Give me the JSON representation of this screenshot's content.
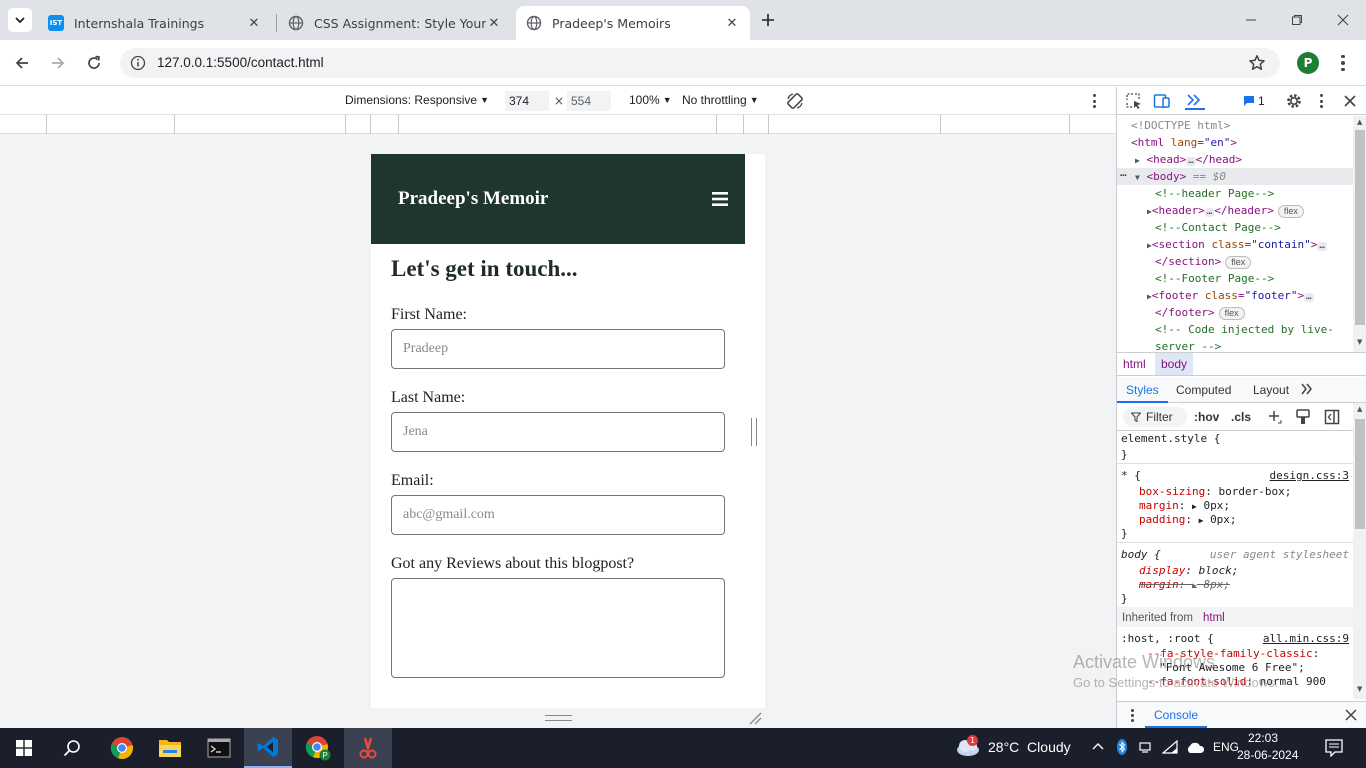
{
  "browser": {
    "tabs": [
      {
        "title": "Internshala Trainings",
        "favicon": "internshala-icon",
        "favicon_text": "IST",
        "active": false
      },
      {
        "title": "CSS Assignment: Style Your Pers",
        "favicon": "globe-icon",
        "active": false
      },
      {
        "title": "Pradeep's Memoirs",
        "favicon": "globe-icon",
        "active": true
      }
    ],
    "url": "127.0.0.1:5500/contact.html",
    "profile_initial": "P"
  },
  "device_toolbar": {
    "dimensions_label": "Dimensions: Responsive",
    "width": "374",
    "height": "554",
    "times": "×",
    "zoom": "100%",
    "throttling": "No throttling"
  },
  "page": {
    "brand": "Pradeep's Memoir",
    "heading": "Let's get in touch...",
    "fields": [
      {
        "label": "First Name:",
        "placeholder": "Pradeep"
      },
      {
        "label": "Last Name:",
        "placeholder": "Jena"
      },
      {
        "label": "Email:",
        "placeholder": "abc@gmail.com"
      }
    ],
    "review_label": "Got any Reviews about this blogpost?"
  },
  "devtools": {
    "issues_count": "1",
    "elements": {
      "doctype": "<!DOCTYPE html>",
      "html_open": "<html",
      "html_attr": "lang",
      "html_val": "\"en\"",
      "head_open": "<head>",
      "head_close": "</head>",
      "body_open": "<body>",
      "body_eq": "== $0",
      "c_header": "<!--header Page-->",
      "header_open": "<header>",
      "header_close": "</header>",
      "c_contact": "<!--Contact Page-->",
      "section_open": "<section",
      "section_attr": "class",
      "section_val": "\"contain\"",
      "section_close": "</section>",
      "c_footer": "<!--Footer Page-->",
      "footer_open": "<footer",
      "footer_attr": "class",
      "footer_val": "\"footer\"",
      "footer_close": "</footer>",
      "c_live1": "<!-- Code injected by live-",
      "c_live2": "server -->",
      "flex": "flex",
      "ellipsis": "…"
    },
    "breadcrumb": [
      "html",
      "body"
    ],
    "styles_tabs": [
      "Styles",
      "Computed",
      "Layout"
    ],
    "filter_label": "Filter",
    "hov": ":hov",
    "cls": ".cls",
    "rules": {
      "element_style": "element.style {",
      "close_brace": "}",
      "star_selector": "* {",
      "design_link": "design.css:3",
      "box_sizing_prop": "box-sizing",
      "box_sizing_val": "border-box;",
      "margin_prop": "margin",
      "margin_val": "0px;",
      "padding_prop": "padding",
      "padding_val": "0px;",
      "body_selector": "body {",
      "ua_label": "user agent stylesheet",
      "display_prop": "display",
      "display_val": "block;",
      "margin_struck_prop": "margin",
      "margin_struck_val": "8px;",
      "inherited_label": "Inherited from",
      "inherited_tag": "html",
      "root_selector": ":host, :root {",
      "fa_link": "all.min.css:9",
      "fa_family_prop": "--fa-style-family-classic",
      "fa_family_val": "\"Font Awesome 6 Free\";",
      "fa_solid_prop": "--fa-font-solid",
      "fa_solid_val": "normal 900"
    },
    "drawer_tab": "Console"
  },
  "taskbar": {
    "weather": "28°C  Cloudy",
    "weather_badge": "1",
    "language": "ENG",
    "time": "22:03",
    "date": "28-06-2024"
  },
  "watermark": {
    "line1": "Activate Windows",
    "line2": "Go to Settings to activate Windows."
  },
  "colors": {
    "header_bg": "#1f3630",
    "tabstrip_bg": "#dfe3e7",
    "devtools_accent": "#1a73e8",
    "taskbar_bg": "#1b1f2b"
  }
}
